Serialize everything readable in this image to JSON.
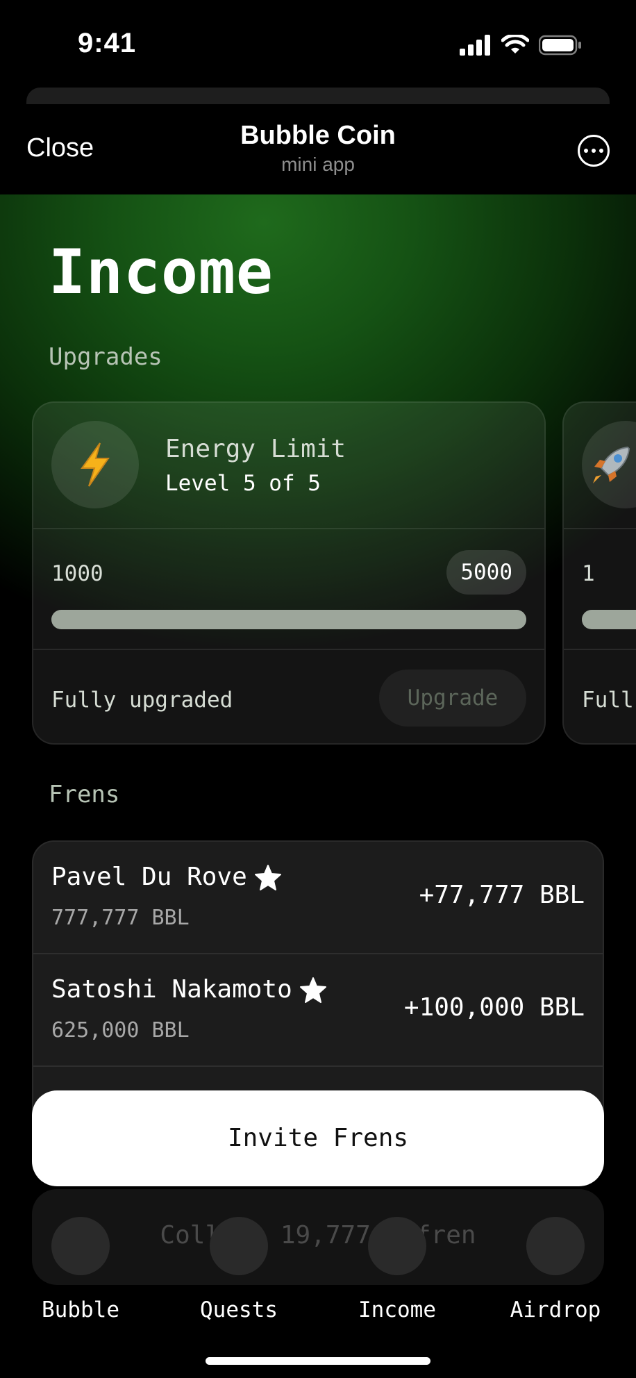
{
  "status_bar": {
    "time": "9:41"
  },
  "header": {
    "close_label": "Close",
    "title": "Bubble Coin",
    "subtitle": "mini app"
  },
  "page": {
    "title": "Income"
  },
  "upgrades": {
    "section_label": "Upgrades",
    "cards": [
      {
        "icon": "lightning-icon",
        "name": "Energy Limit",
        "level": "Level 5 of 5",
        "from": "1000",
        "to": "5000",
        "progress": 1.0,
        "status": "Fully upgraded",
        "button_label": "Upgrade"
      },
      {
        "icon": "rocket-icon",
        "from": "1",
        "status": "Full"
      }
    ]
  },
  "frens": {
    "section_label": "Frens",
    "items": [
      {
        "name": "Pavel Du Rove",
        "balance": "777,777 BBL",
        "reward": "+77,777 BBL",
        "icon": "star-icon"
      },
      {
        "name": "Satoshi Nakamoto",
        "balance": "625,000 BBL",
        "reward": "+100,000 BBL",
        "icon": "star-icon"
      }
    ],
    "invite_label": "Invite Frens"
  },
  "collect_text": "Collect 19,777 , fren",
  "nav": {
    "items": [
      "Bubble",
      "Quests",
      "Income",
      "Airdrop"
    ]
  },
  "colors": {
    "accent": "#1f6a1c",
    "background": "#000000",
    "button_bg": "#ffffff"
  }
}
